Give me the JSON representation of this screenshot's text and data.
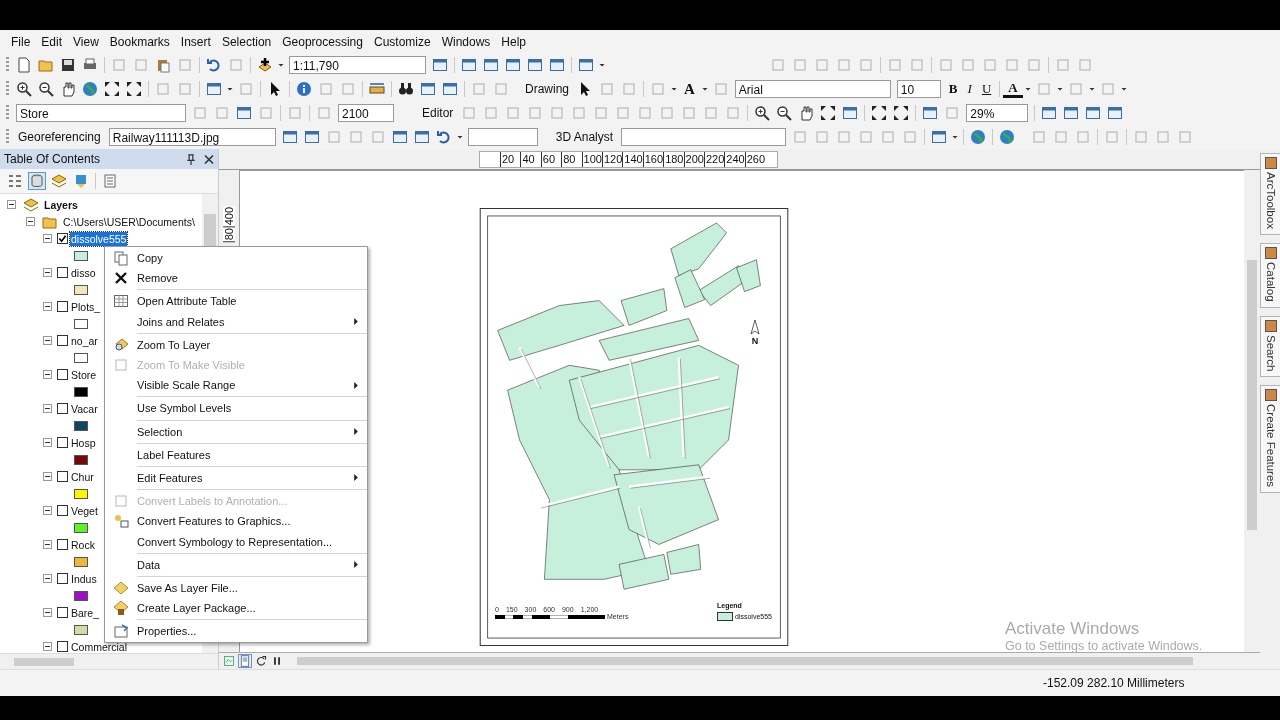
{
  "menu_bar": [
    "File",
    "Edit",
    "View",
    "Bookmarks",
    "Insert",
    "Selection",
    "Geoprocessing",
    "Customize",
    "Windows",
    "Help"
  ],
  "toolbars": {
    "scale": "1:11,790",
    "drawing_menu": "Drawing",
    "text_tool": "A",
    "font": "Arial",
    "font_size": "10",
    "bold": "B",
    "italic": "I",
    "underline": "U",
    "font_color": "A",
    "target_layer": "Store",
    "reference_scale": "2100",
    "editor_menu": "Editor",
    "layout_zoom": "29%",
    "georeferencing_menu": "Georeferencing",
    "raster_layer": "Railway111113D.jpg",
    "analyst_menu": "3D Analyst"
  },
  "toc": {
    "title": "Table Of Contents",
    "tree": [
      {
        "label": "Layers",
        "expanded": true,
        "children": [
          {
            "label": "C:\\Users\\USER\\Documents\\",
            "expanded": true,
            "children": [
              {
                "label": "dissolve555",
                "expanded": true,
                "checked": true,
                "selected": true,
                "color": "#c6efdc"
              },
              {
                "label": "disso",
                "expanded": true,
                "checked": false,
                "selected": false,
                "color": "#f6e4c0"
              },
              {
                "label": "Plots_",
                "expanded": true,
                "checked": false,
                "selected": false,
                "color": "#ffffff"
              },
              {
                "label": "no_ar",
                "expanded": true,
                "checked": false,
                "selected": false,
                "color": "#ffffff"
              },
              {
                "label": "Store",
                "expanded": true,
                "checked": false,
                "selected": false,
                "color": "#000000"
              },
              {
                "label": "Vacar",
                "expanded": true,
                "checked": false,
                "selected": false,
                "color": "#0e4668"
              },
              {
                "label": "Hosp",
                "expanded": true,
                "checked": false,
                "selected": false,
                "color": "#7a0808"
              },
              {
                "label": "Chur",
                "expanded": true,
                "checked": false,
                "selected": false,
                "color": "#f8f800"
              },
              {
                "label": "Veget",
                "expanded": true,
                "checked": false,
                "selected": false,
                "color": "#5ef02a"
              },
              {
                "label": "Rock",
                "expanded": true,
                "checked": false,
                "selected": false,
                "color": "#f0b43c"
              },
              {
                "label": "Indus",
                "expanded": true,
                "checked": false,
                "selected": false,
                "color": "#a010c8"
              },
              {
                "label": "Bare_",
                "expanded": true,
                "checked": false,
                "selected": false,
                "color": "#d4dca4"
              },
              {
                "label": "Commercial",
                "expanded": true,
                "checked": false,
                "selected": false
              }
            ]
          }
        ]
      }
    ]
  },
  "context_menu": [
    {
      "label": "Copy",
      "disabled": false,
      "submenu": false,
      "separator_before": false
    },
    {
      "label": "Remove",
      "disabled": false,
      "submenu": false,
      "separator_before": false
    },
    {
      "label": "Open Attribute Table",
      "disabled": false,
      "submenu": false,
      "separator_before": true
    },
    {
      "label": "Joins and Relates",
      "disabled": false,
      "submenu": true,
      "separator_before": false
    },
    {
      "label": "Zoom To Layer",
      "disabled": false,
      "submenu": false,
      "separator_before": true
    },
    {
      "label": "Zoom To Make Visible",
      "disabled": true,
      "submenu": false,
      "separator_before": false
    },
    {
      "label": "Visible Scale Range",
      "disabled": false,
      "submenu": true,
      "separator_before": false
    },
    {
      "label": "Use Symbol Levels",
      "disabled": false,
      "submenu": false,
      "separator_before": true
    },
    {
      "label": "Selection",
      "disabled": false,
      "submenu": true,
      "separator_before": true
    },
    {
      "label": "Label Features",
      "disabled": false,
      "submenu": false,
      "separator_before": true
    },
    {
      "label": "Edit Features",
      "disabled": false,
      "submenu": true,
      "separator_before": true
    },
    {
      "label": "Convert Labels to Annotation...",
      "disabled": true,
      "submenu": false,
      "separator_before": true
    },
    {
      "label": "Convert Features to Graphics...",
      "disabled": false,
      "submenu": false,
      "separator_before": false
    },
    {
      "label": "Convert Symbology to Representation...",
      "disabled": false,
      "submenu": false,
      "separator_before": false
    },
    {
      "label": "Data",
      "disabled": false,
      "submenu": true,
      "separator_before": true
    },
    {
      "label": "Save As Layer File...",
      "disabled": false,
      "submenu": false,
      "separator_before": true
    },
    {
      "label": "Create Layer Package...",
      "disabled": false,
      "submenu": false,
      "separator_before": false
    },
    {
      "label": "Properties...",
      "disabled": false,
      "submenu": false,
      "separator_before": true
    }
  ],
  "map_view": {
    "top_ruler": [
      "20",
      "40",
      "60",
      "80",
      "100",
      "120",
      "140",
      "160",
      "180",
      "200",
      "220",
      "240",
      "260"
    ],
    "side_ruler": [
      "80",
      "400"
    ],
    "layout": {
      "north_label": "N",
      "scale_labels": [
        "0",
        "150",
        "300",
        "600",
        "900",
        "1,200"
      ],
      "scale_unit": "Meters",
      "legend_title": "Legend",
      "legend_item": "dissolve555"
    }
  },
  "dock_tabs": [
    "ArcToolbox",
    "Catalog",
    "Search",
    "Create Features"
  ],
  "activation_notice": {
    "title": "Activate Windows",
    "hint": "Go to Settings to activate Windows."
  },
  "status_bar": {
    "coordinates": "-152.09  282.10 Millimeters"
  }
}
